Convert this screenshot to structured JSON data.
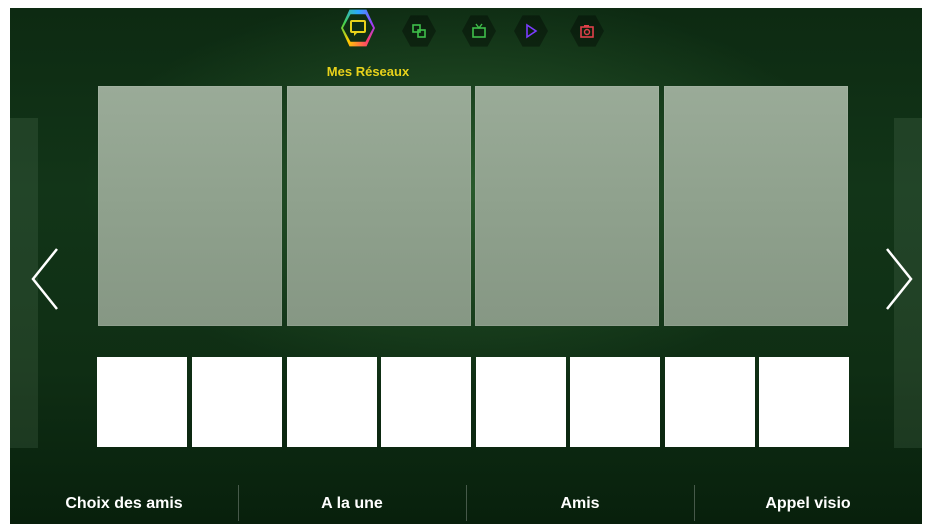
{
  "nav": {
    "active_label": "Mes Réseaux",
    "items": [
      {
        "icon": "social-chat-icon",
        "color": "#e8d21b",
        "active": true
      },
      {
        "icon": "apps-icon",
        "color": "#3fbf4a",
        "active": false
      },
      {
        "icon": "tv-icon",
        "color": "#3fbf4a",
        "active": false
      },
      {
        "icon": "play-icon",
        "color": "#7b3cff",
        "active": false
      },
      {
        "icon": "camera-icon",
        "color": "#e0404a",
        "active": false
      }
    ]
  },
  "bottom_menu": {
    "items": [
      {
        "label": "Choix des amis"
      },
      {
        "label": "A la une"
      },
      {
        "label": "Amis"
      },
      {
        "label": "Appel visio"
      }
    ]
  },
  "colors": {
    "accent": "#e8d21b",
    "background": "#123518",
    "tile": "#8fa18d"
  }
}
